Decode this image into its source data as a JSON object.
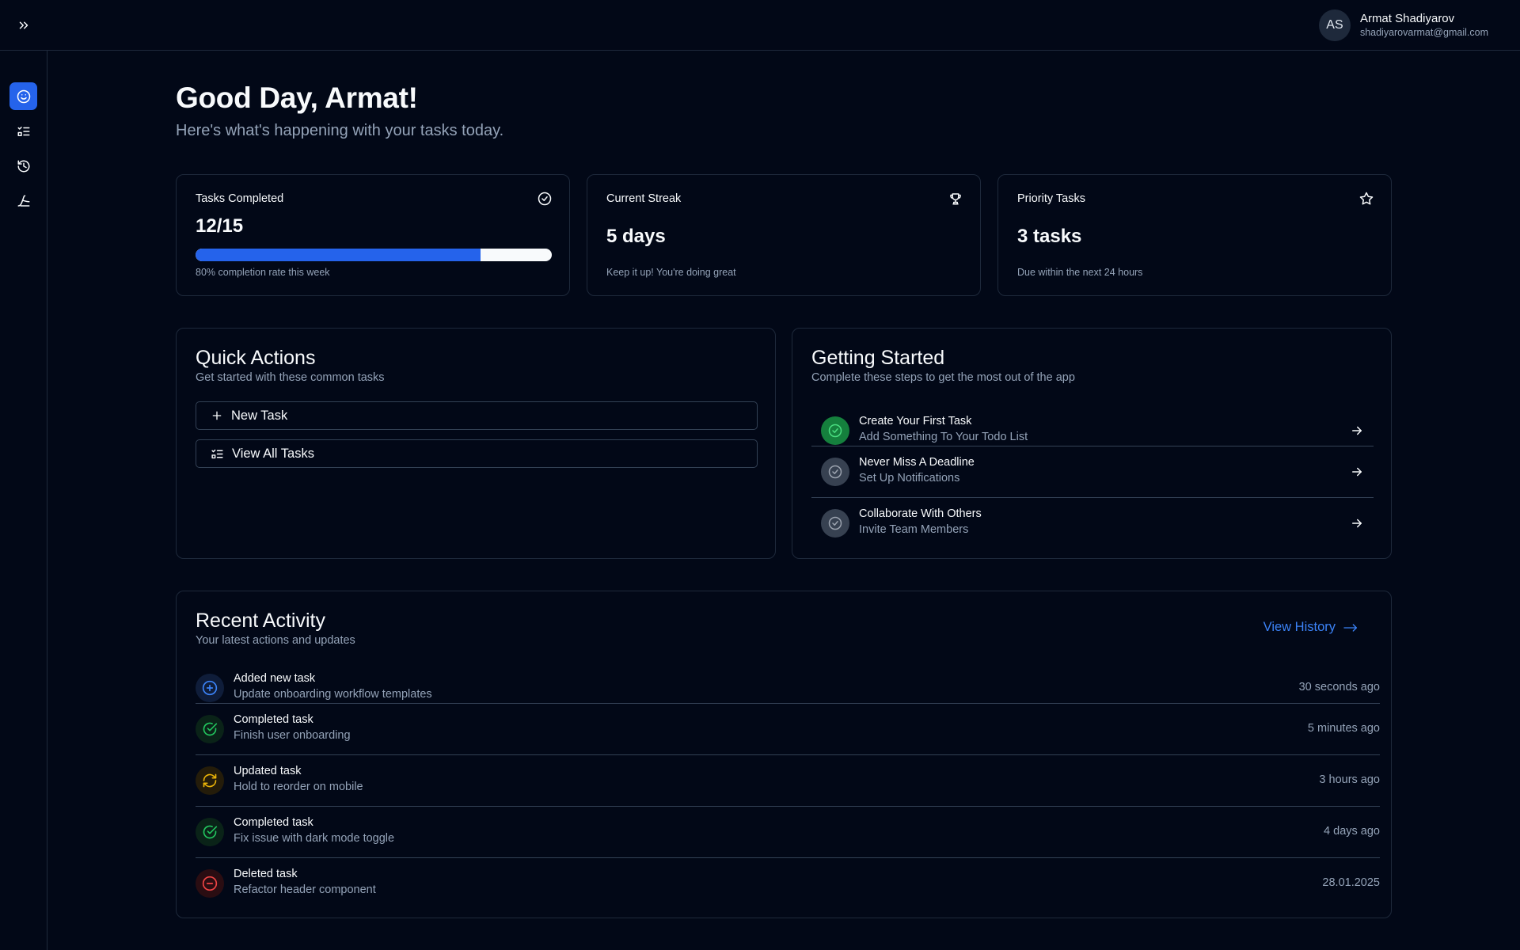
{
  "user": {
    "initials": "AS",
    "name": "Armat Shadiyarov",
    "email": "shadiyarovarmat@gmail.com"
  },
  "sidebar": {
    "items": [
      {
        "icon": "smile-icon",
        "active": true
      },
      {
        "icon": "list-checks-icon",
        "active": false
      },
      {
        "icon": "history-icon",
        "active": false
      },
      {
        "icon": "chart-icon",
        "active": false
      }
    ]
  },
  "header": {
    "greeting": "Good Day, Armat!",
    "subtitle": "Here's what's happening with your tasks today."
  },
  "stats": {
    "completed": {
      "title": "Tasks Completed",
      "value": "12/15",
      "progress_percent": 80,
      "note": "80% completion rate this week",
      "icon": "check-circle-icon"
    },
    "streak": {
      "title": "Current Streak",
      "value": "5 days",
      "note": "Keep it up! You're doing great",
      "icon": "trophy-icon"
    },
    "priority": {
      "title": "Priority Tasks",
      "value": "3 tasks",
      "note": "Due within the next 24 hours",
      "icon": "star-icon"
    }
  },
  "quick_actions": {
    "title": "Quick Actions",
    "subtitle": "Get started with these common tasks",
    "buttons": [
      {
        "label": "New Task",
        "icon": "plus-icon"
      },
      {
        "label": "View All Tasks",
        "icon": "list-checks-icon"
      }
    ]
  },
  "getting_started": {
    "title": "Getting Started",
    "subtitle": "Complete these steps to get the most out of the app",
    "steps": [
      {
        "title": "Create Your First Task",
        "description": "Add Something To Your Todo List",
        "done": true
      },
      {
        "title": "Never Miss A Deadline",
        "description": "Set Up Notifications",
        "done": false
      },
      {
        "title": "Collaborate With Others",
        "description": "Invite Team Members",
        "done": false
      }
    ]
  },
  "recent_activity": {
    "title": "Recent Activity",
    "subtitle": "Your latest actions and updates",
    "view_history": "View History",
    "items": [
      {
        "type": "added",
        "title": "Added new task",
        "description": "Update onboarding workflow templates",
        "time": "30 seconds ago"
      },
      {
        "type": "completed",
        "title": "Completed task",
        "description": "Finish user onboarding",
        "time": "5 minutes ago"
      },
      {
        "type": "updated",
        "title": "Updated task",
        "description": "Hold to reorder on mobile",
        "time": "3 hours ago"
      },
      {
        "type": "completed",
        "title": "Completed task",
        "description": "Fix issue with dark mode toggle",
        "time": "4 days ago"
      },
      {
        "type": "deleted",
        "title": "Deleted task",
        "description": "Refactor header component",
        "time": "28.01.2025"
      }
    ]
  },
  "colors": {
    "background": "#020817",
    "accent": "#2563eb",
    "success": "#22c55e",
    "warning": "#eab308",
    "danger": "#ef4444"
  }
}
